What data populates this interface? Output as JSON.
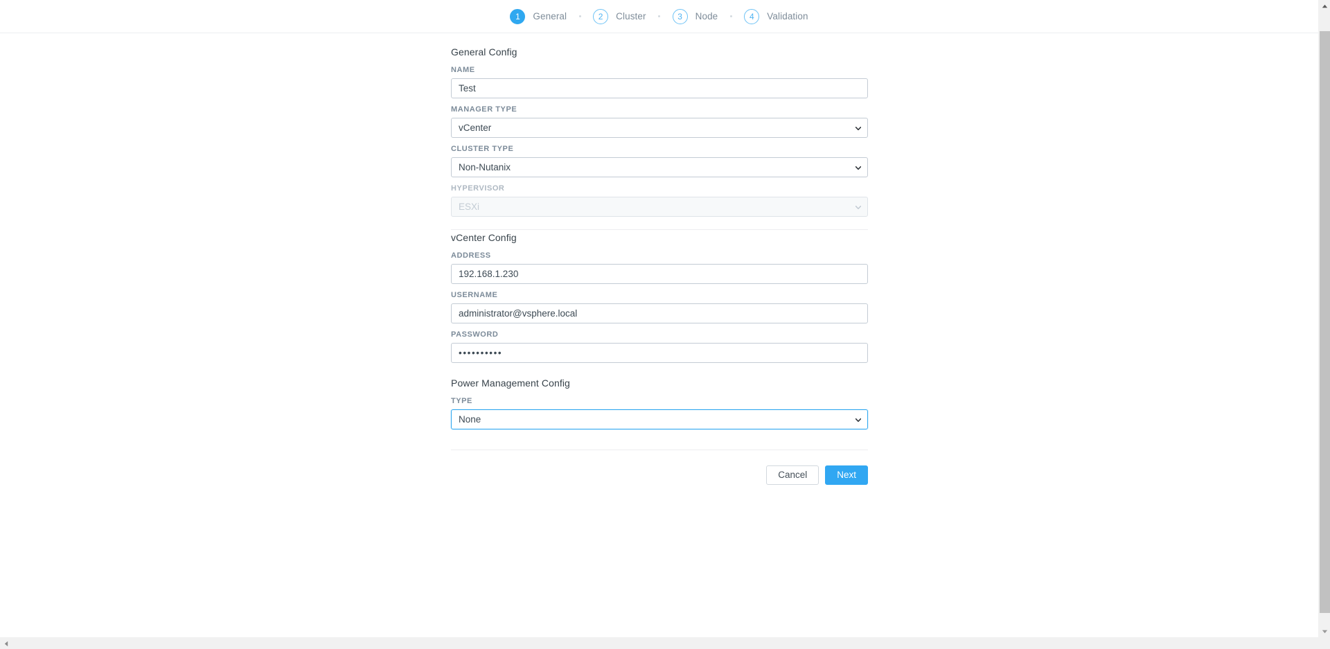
{
  "wizard": {
    "steps": [
      {
        "number": "1",
        "label": "General",
        "state": "active"
      },
      {
        "number": "2",
        "label": "Cluster",
        "state": "inactive"
      },
      {
        "number": "3",
        "label": "Node",
        "state": "inactive"
      },
      {
        "number": "4",
        "label": "Validation",
        "state": "inactive"
      }
    ]
  },
  "general_config": {
    "title": "General Config",
    "name": {
      "label": "NAME",
      "value": "Test",
      "placeholder": ""
    },
    "manager_type": {
      "label": "MANAGER TYPE",
      "value": "vCenter"
    },
    "cluster_type": {
      "label": "CLUSTER TYPE",
      "value": "Non-Nutanix"
    },
    "hypervisor": {
      "label": "HYPERVISOR",
      "value": "ESXi",
      "disabled": true
    }
  },
  "vcenter_config": {
    "title": "vCenter Config",
    "address": {
      "label": "ADDRESS",
      "value": "192.168.1.230",
      "placeholder": ""
    },
    "username": {
      "label": "USERNAME",
      "value": "administrator@vsphere.local",
      "placeholder": ""
    },
    "password": {
      "label": "PASSWORD",
      "value": "••••••••••",
      "placeholder": ""
    }
  },
  "power_management_config": {
    "title": "Power Management Config",
    "type": {
      "label": "TYPE",
      "value": "None",
      "focused": true
    }
  },
  "footer": {
    "cancel_label": "Cancel",
    "next_label": "Next"
  },
  "colors": {
    "accent": "#31a7f2",
    "step_active_bg": "#2fa8f0",
    "step_inactive_border": "#6dc2f5",
    "label_text": "#7c8b99",
    "input_border": "#c3cbd4",
    "divider": "#ededf0"
  }
}
